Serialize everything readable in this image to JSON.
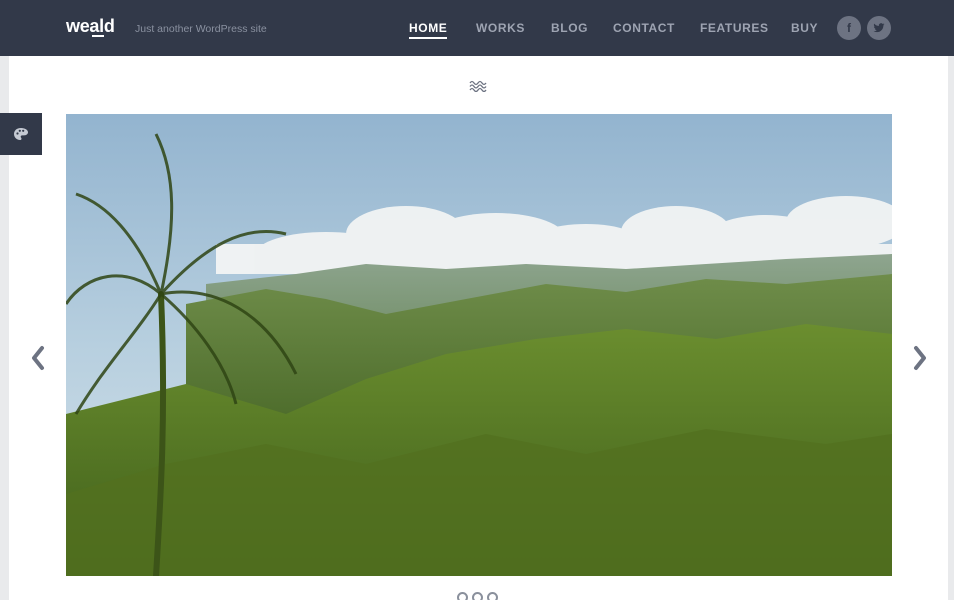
{
  "site": {
    "logo": "weald",
    "tagline": "Just another WordPress site"
  },
  "nav": {
    "items": [
      {
        "label": "HOME",
        "active": true
      },
      {
        "label": "WORKS",
        "active": false
      },
      {
        "label": "BLOG",
        "active": false
      },
      {
        "label": "CONTACT",
        "active": false
      },
      {
        "label": "FEATURES",
        "active": false
      },
      {
        "label": "BUY",
        "active": false
      }
    ]
  },
  "social": [
    {
      "icon": "facebook-icon",
      "glyph": "f"
    },
    {
      "icon": "twitter-icon"
    }
  ],
  "content": {
    "divider_icon": "wave-icon",
    "side_tab_icon": "palette-icon"
  },
  "slider": {
    "image_subject": "tropical hills landscape with palm tree and clouds",
    "total_slides": 3,
    "active_slide": 1
  },
  "colors": {
    "header_bg": "#323949",
    "nav_text": "#9ea4b2",
    "nav_active": "#ffffff",
    "accent_icon": "#6d7382"
  }
}
